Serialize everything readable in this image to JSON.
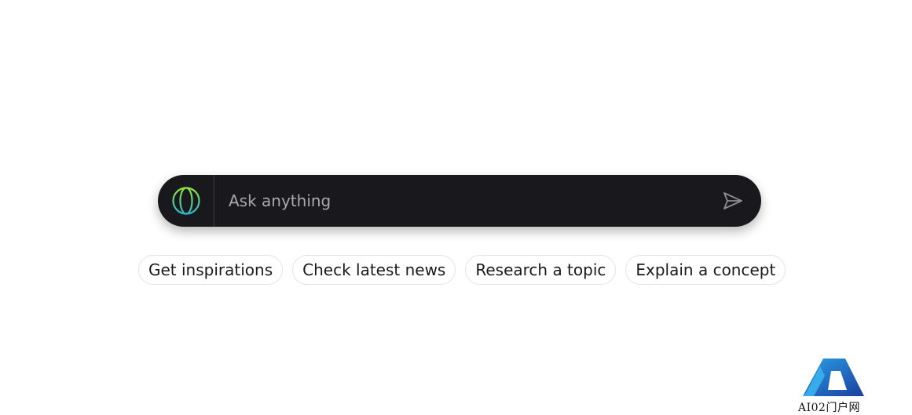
{
  "search": {
    "placeholder": "Ask anything",
    "value": ""
  },
  "icons": {
    "globe": "globe-icon",
    "send": "send-icon"
  },
  "suggestions": [
    {
      "label": "Get inspirations"
    },
    {
      "label": "Check latest news"
    },
    {
      "label": "Research a topic"
    },
    {
      "label": "Explain a concept"
    }
  ],
  "watermark": {
    "text": "AI02门户网"
  },
  "colors": {
    "bar_bg": "#19181c",
    "globe_gradient_start": "#8ee53f",
    "globe_gradient_end": "#2fb5c9",
    "chip_border": "#e3e3e6"
  }
}
